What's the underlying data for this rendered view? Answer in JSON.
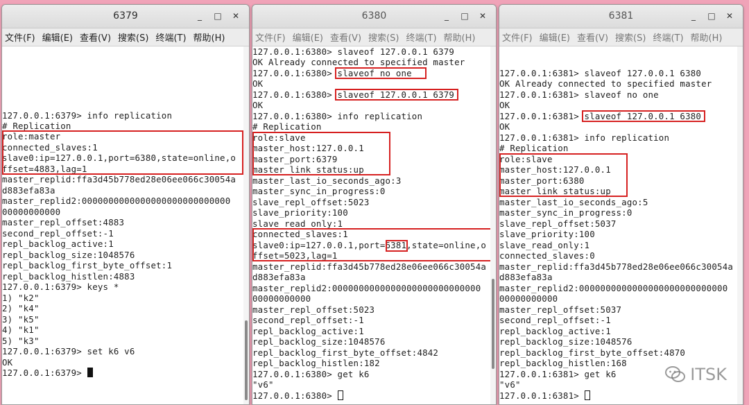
{
  "windows": [
    {
      "title": "6379",
      "active": true,
      "menu": [
        "文件(F)",
        "编辑(E)",
        "查看(V)",
        "搜索(S)",
        "终端(T)",
        "帮助(H)"
      ],
      "lines": [
        "127.0.0.1:6379> info replication",
        "# Replication",
        "role:master",
        "connected_slaves:1",
        "slave0:ip=127.0.0.1,port=6380,state=online,o",
        "ffset=4883,lag=1",
        "master_replid:ffa3d45b778ed28e06ee066c30054a",
        "d883efa83a",
        "master_replid2:0000000000000000000000000000",
        "00000000000",
        "master_repl_offset:4883",
        "second_repl_offset:-1",
        "repl_backlog_active:1",
        "repl_backlog_size:1048576",
        "repl_backlog_first_byte_offset:1",
        "repl_backlog_histlen:4883",
        "127.0.0.1:6379> keys *",
        "1) \"k2\"",
        "2) \"k4\"",
        "3) \"k5\"",
        "4) \"k1\"",
        "5) \"k3\"",
        "127.0.0.1:6379> set k6 v6",
        "OK",
        "127.0.0.1:6379> "
      ]
    },
    {
      "title": "6380",
      "active": false,
      "menu": [
        "文件(F)",
        "编辑(E)",
        "查看(V)",
        "搜索(S)",
        "终端(T)",
        "帮助(H)"
      ],
      "lines": [
        "127.0.0.1:6380> slaveof 127.0.0.1 6379",
        "OK Already connected to specified master",
        "127.0.0.1:6380> slaveof no one",
        "OK",
        "127.0.0.1:6380> slaveof 127.0.0.1 6379",
        "OK",
        "127.0.0.1:6380> info replication",
        "# Replication",
        "role:slave",
        "master_host:127.0.0.1",
        "master_port:6379",
        "master_link_status:up",
        "master_last_io_seconds_ago:3",
        "master_sync_in_progress:0",
        "slave_repl_offset:5023",
        "slave_priority:100",
        "slave_read_only:1",
        "connected_slaves:1",
        "slave0:ip=127.0.0.1,port=6381,state=online,o",
        "ffset=5023,lag=1",
        "master_replid:ffa3d45b778ed28e06ee066c30054a",
        "d883efa83a",
        "master_replid2:0000000000000000000000000000",
        "00000000000",
        "master_repl_offset:5023",
        "second_repl_offset:-1",
        "repl_backlog_active:1",
        "repl_backlog_size:1048576",
        "repl_backlog_first_byte_offset:4842",
        "repl_backlog_histlen:182",
        "127.0.0.1:6380> get k6",
        "\"v6\"",
        "127.0.0.1:6380> "
      ]
    },
    {
      "title": "6381",
      "active": false,
      "menu": [
        "文件(F)",
        "编辑(E)",
        "查看(V)",
        "搜索(S)",
        "终端(T)",
        "帮助(H)"
      ],
      "lines": [
        "127.0.0.1:6381> slaveof 127.0.0.1 6380",
        "OK Already connected to specified master",
        "127.0.0.1:6381> slaveof no one",
        "OK",
        "127.0.0.1:6381> slaveof 127.0.0.1 6380",
        "OK",
        "127.0.0.1:6381> info replication",
        "# Replication",
        "role:slave",
        "master_host:127.0.0.1",
        "master_port:6380",
        "master_link_status:up",
        "master_last_io_seconds_ago:5",
        "master_sync_in_progress:0",
        "slave_repl_offset:5037",
        "slave_priority:100",
        "slave_read_only:1",
        "connected_slaves:0",
        "master_replid:ffa3d45b778ed28e06ee066c30054a",
        "d883efa83a",
        "master_replid2:0000000000000000000000000000",
        "00000000000",
        "master_repl_offset:5037",
        "second_repl_offset:-1",
        "repl_backlog_active:1",
        "repl_backlog_size:1048576",
        "repl_backlog_first_byte_offset:4870",
        "repl_backlog_histlen:168",
        "127.0.0.1:6381> get k6",
        "\"v6\"",
        "127.0.0.1:6381> "
      ]
    }
  ],
  "window_controls": {
    "minimize": "_",
    "maximize": "□",
    "close": "✕"
  },
  "watermark": {
    "icon": "wechat-icon",
    "text": "ITSK"
  },
  "colors": {
    "background": "#f0a3b8",
    "highlight": "#d62020"
  }
}
